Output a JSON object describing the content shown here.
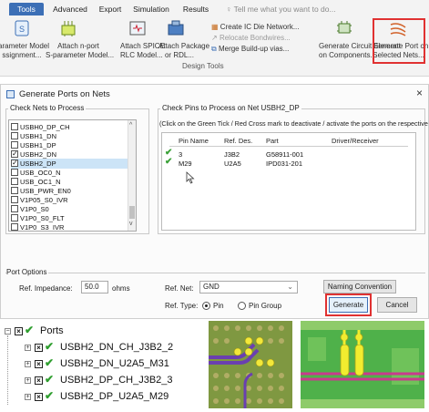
{
  "ribbon": {
    "tabs": [
      "Tools",
      "Advanced",
      "Export",
      "Simulation",
      "Results"
    ],
    "active_tab": "Tools",
    "tell_me": "Tell me what you want to do...",
    "buttons": {
      "param_model": {
        "line1": "arameter Model",
        "line2": "ssignment..."
      },
      "attach_nport": {
        "line1": "Attach n-port",
        "line2": "S-parameter Model..."
      },
      "attach_spice": {
        "line1": "Attach SPICE",
        "line2": "RLC Model..."
      },
      "attach_package": {
        "line1": "Attach Package",
        "line2": "or RDL..."
      },
      "create_ic_die": "Create IC Die Network...",
      "relocate_bondwires": "Relocate Bondwires...",
      "merge_buildup": "Merge Build-up vias...",
      "gen_circuit_element": {
        "line1": "Generate Circuit Element",
        "line2": "on Components..."
      },
      "gen_port": {
        "line1": "Generate Port on",
        "line2": "Selected Nets..."
      }
    },
    "group_label": "Design Tools"
  },
  "dialog": {
    "title": "Generate Ports on Nets",
    "close": "×",
    "nets_group": "Check Nets to Process",
    "nets": [
      {
        "name": "USBH0_DP_CH",
        "checked": false,
        "selected": false
      },
      {
        "name": "USBH1_DN",
        "checked": false,
        "selected": false
      },
      {
        "name": "USBH1_DP",
        "checked": false,
        "selected": false
      },
      {
        "name": "USBH2_DN",
        "checked": true,
        "selected": false
      },
      {
        "name": "USBH2_DP",
        "checked": true,
        "selected": true
      },
      {
        "name": "USB_OC0_N",
        "checked": false,
        "selected": false
      },
      {
        "name": "USB_OC1_N",
        "checked": false,
        "selected": false
      },
      {
        "name": "USB_PWR_EN0",
        "checked": false,
        "selected": false
      },
      {
        "name": "V1P05_S0_IVR",
        "checked": false,
        "selected": false
      },
      {
        "name": "V1P0_S0",
        "checked": false,
        "selected": false
      },
      {
        "name": "V1P0_S0_FLT",
        "checked": false,
        "selected": false
      },
      {
        "name": "V1P0_S3_IVR",
        "checked": false,
        "selected": false
      }
    ],
    "pins_group": "Check Pins to Process on Net USBH2_DP",
    "pins_hint": "(Click on the Green Tick / Red Cross mark to deactivate / activate the ports on the respective pins)",
    "pin_columns": [
      "Pin Name",
      "Ref. Des.",
      "Part",
      "Driver/Receiver"
    ],
    "pins": [
      {
        "pin": "3",
        "ref": "J3B2",
        "part": "G58911-001",
        "driver": ""
      },
      {
        "pin": "M29",
        "ref": "U2A5",
        "part": "IPD031-201",
        "driver": ""
      }
    ],
    "port_options": "Port Options",
    "ref_impedance_label": "Ref. Impedance:",
    "ref_impedance_value": "50.0",
    "ohms": "ohms",
    "ref_net_label": "Ref. Net:",
    "ref_net_value": "GND",
    "naming_convention": "Naming Convention",
    "ref_type_label": "Ref. Type:",
    "ref_type_pin": "Pin",
    "ref_type_pin_group": "Pin Group",
    "generate": "Generate",
    "cancel": "Cancel"
  },
  "tree": {
    "root": "Ports",
    "children": [
      "USBH2_DN_CH_J3B2_2",
      "USBH2_DN_U2A5_M31",
      "USBH2_DP_CH_J3B2_3",
      "USBH2_DP_U2A5_M29"
    ]
  },
  "colors": {
    "accent": "#3c6fb6",
    "highlight": "#e03131",
    "tick_green": "#3aa137"
  }
}
